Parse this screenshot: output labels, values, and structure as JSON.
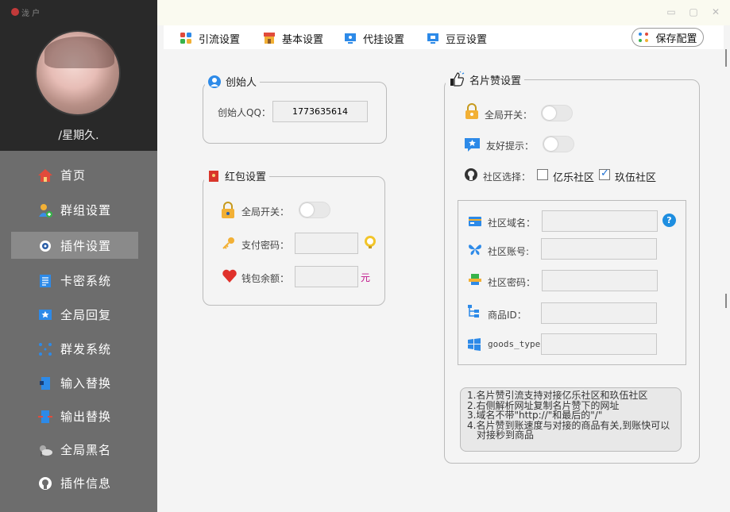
{
  "app": {
    "logo_text": "泷 户"
  },
  "user": {
    "name": "/星期久."
  },
  "sidebar": {
    "items": [
      {
        "label": "首页"
      },
      {
        "label": "群组设置"
      },
      {
        "label": "插件设置"
      },
      {
        "label": "卡密系统"
      },
      {
        "label": "全局回复"
      },
      {
        "label": "群发系统"
      },
      {
        "label": "输入替换"
      },
      {
        "label": "输出替换"
      },
      {
        "label": "全局黑名"
      },
      {
        "label": "插件信息"
      }
    ],
    "active_index": 2
  },
  "window": {
    "minimize": "▭",
    "maximize": "▢",
    "close": "✕"
  },
  "tabs": [
    {
      "label": "引流设置"
    },
    {
      "label": "基本设置"
    },
    {
      "label": "代挂设置"
    },
    {
      "label": "豆豆设置"
    }
  ],
  "save_button": {
    "label": "保存配置"
  },
  "creator": {
    "title": "创始人",
    "qq_label": "创始人QQ：",
    "qq_value": "1773635614"
  },
  "redpacket": {
    "title": "红包设置",
    "switch_label": "全局开关：",
    "password_label": "支付密码：",
    "balance_label": "钱包余额：",
    "balance_unit": "元"
  },
  "card": {
    "title": "名片赞设置",
    "switch_label": "全局开关：",
    "tip_label": "友好提示：",
    "community_label": "社区选择：",
    "community_options": [
      {
        "label": "亿乐社区",
        "checked": false
      },
      {
        "label": "玖伍社区",
        "checked": true
      }
    ],
    "domain_label": "社区域名：",
    "account_label": "社区账号:",
    "password_label": "社区密码：",
    "goods_id_label": "商品ID：",
    "goods_type_label": "goods_type",
    "help_icon": "?",
    "notes": [
      "1.名片赞引流支持对接亿乐社区和玖伍社区",
      "2.右侧解析网址复制名片赞下的网址",
      "3.域名不带\"http://\"和最后的\"/\"",
      "4.名片赞到账速度与对接的商品有关,到账快可以",
      "对接秒到商品"
    ]
  }
}
